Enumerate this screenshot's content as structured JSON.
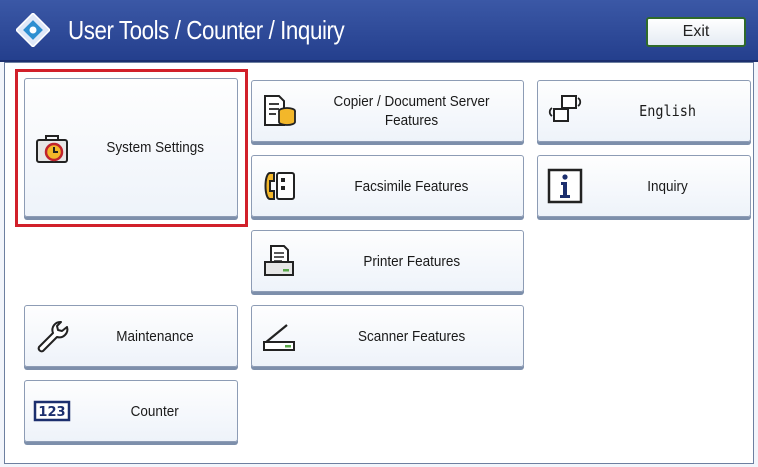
{
  "header": {
    "title": "User Tools / Counter / Inquiry",
    "exit_label": "Exit"
  },
  "buttons": {
    "system_settings": "System Settings",
    "copier": "Copier / Document Server Features",
    "facsimile": "Facsimile Features",
    "printer": "Printer Features",
    "scanner": "Scanner Features",
    "maintenance": "Maintenance",
    "counter": "Counter",
    "english": "English",
    "inquiry": "Inquiry"
  },
  "icons": {
    "app_logo": "user-tools-diamond-icon",
    "system_settings": "toolbox-clock-icon",
    "copier": "document-server-icon",
    "facsimile": "fax-icon",
    "printer": "printer-icon",
    "scanner": "scanner-icon",
    "maintenance": "wrench-icon",
    "counter": "counter-123-icon",
    "english": "language-switch-icon",
    "inquiry": "info-icon"
  },
  "highlight": {
    "target": "system_settings",
    "color": "#d1202a"
  },
  "colors": {
    "header": "#2d4898",
    "exit_border": "#2f6a2a",
    "icon_accent": "#f3b72a"
  }
}
